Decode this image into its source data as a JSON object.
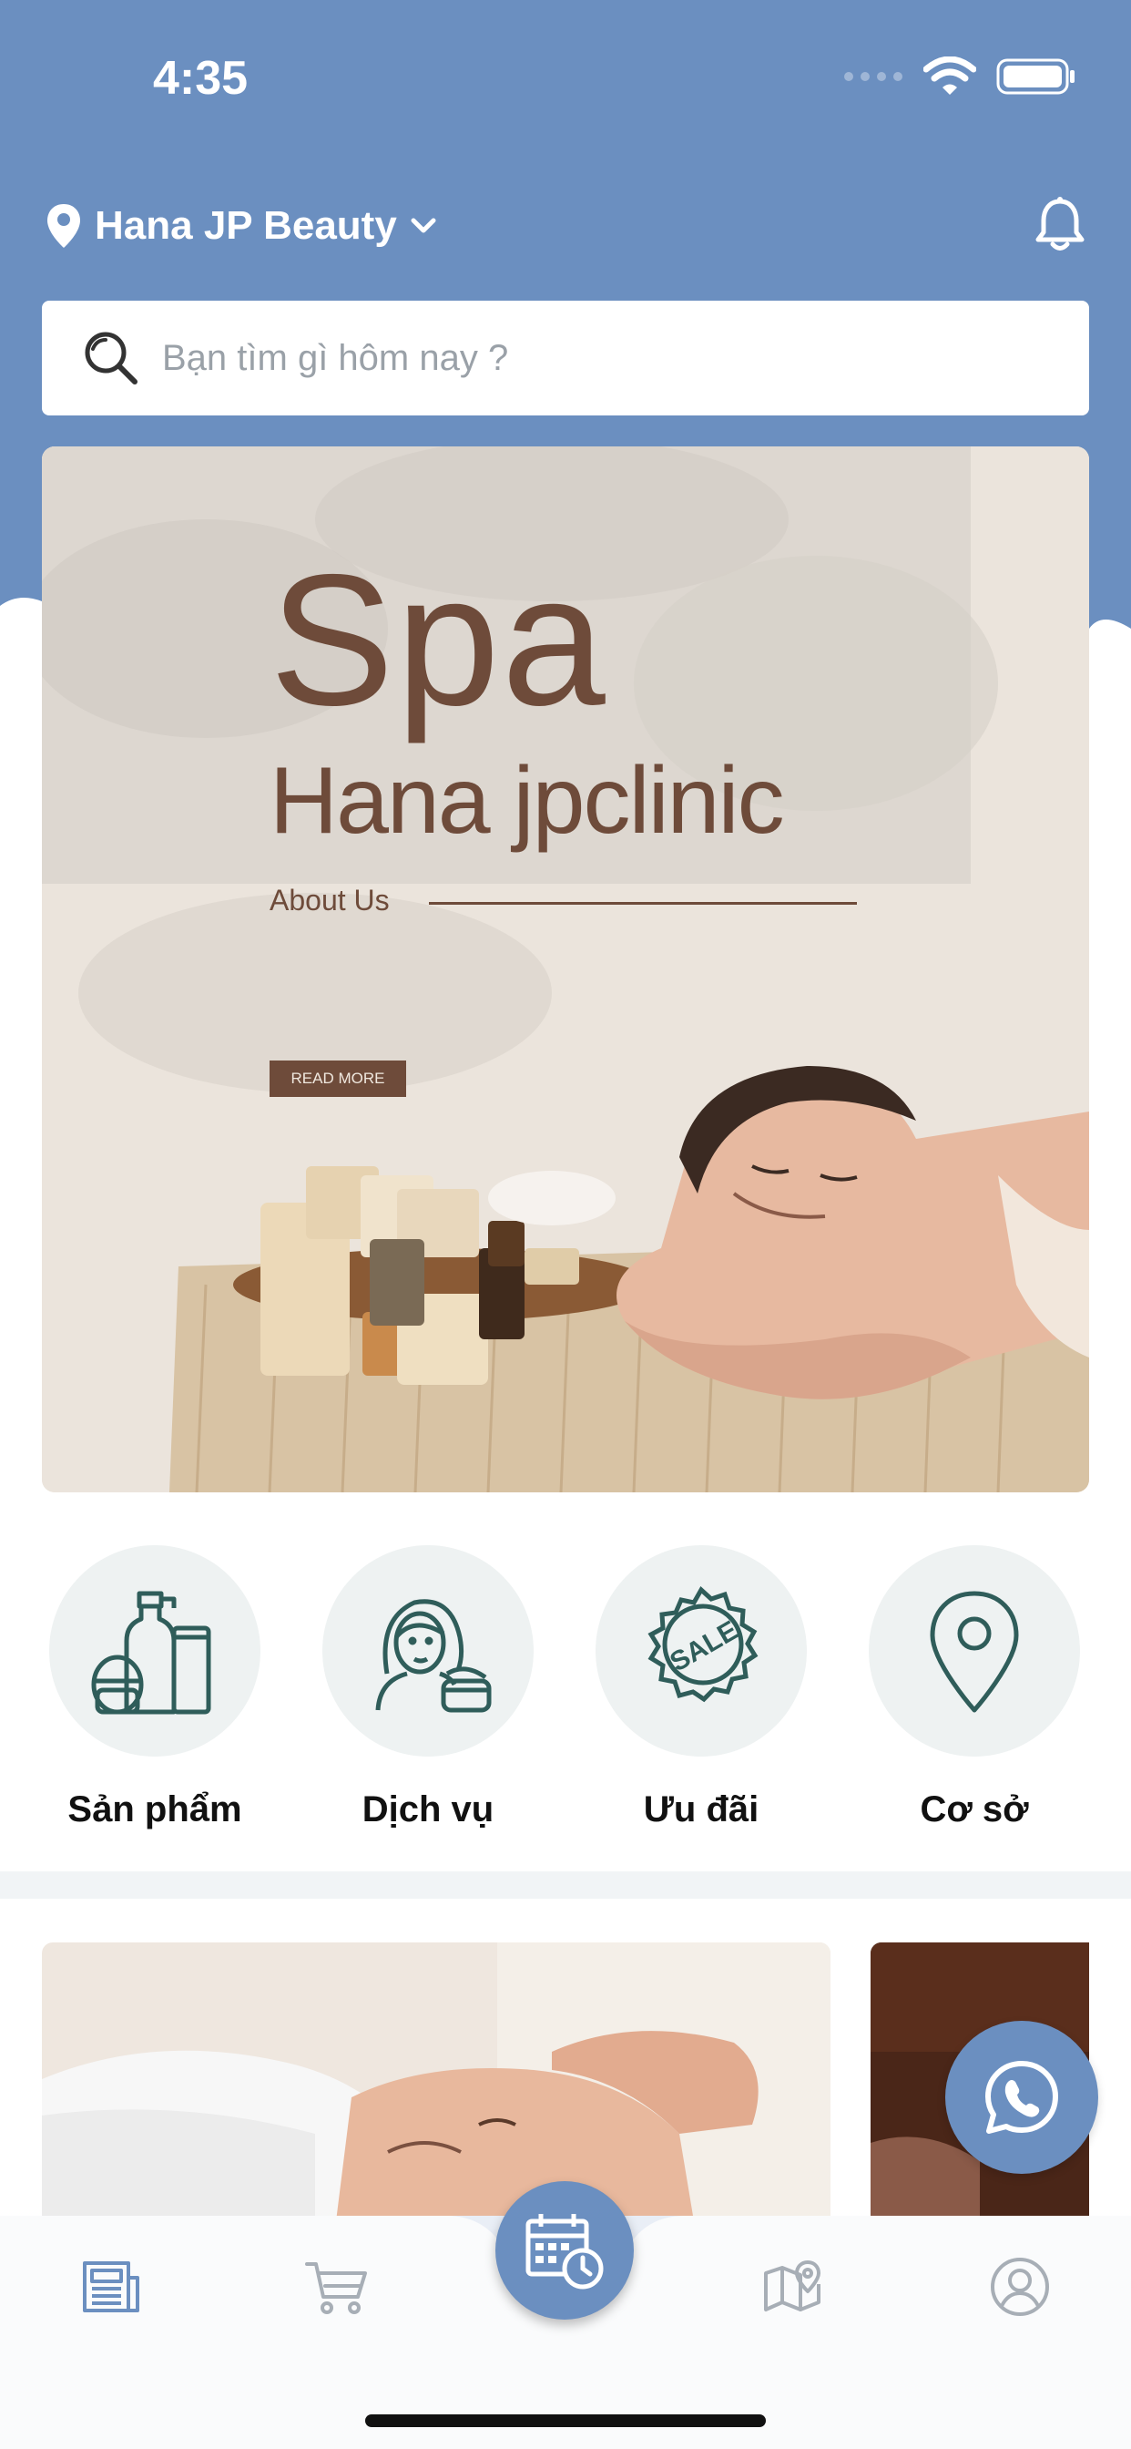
{
  "status": {
    "time": "4:35"
  },
  "header": {
    "location": "Hana JP Beauty"
  },
  "search": {
    "placeholder": "Bạn tìm gì hôm nay ?"
  },
  "banner": {
    "title": "Spa",
    "subtitle": "Hana jpclinic",
    "about": "About Us",
    "button": "READ MORE"
  },
  "categories": [
    {
      "label": "Sản phẩm",
      "icon": "cosmetics-icon"
    },
    {
      "label": "Dịch vụ",
      "icon": "service-woman-icon"
    },
    {
      "label": "Ưu đãi",
      "icon": "sale-badge-icon"
    },
    {
      "label": "Cơ sở",
      "icon": "map-pin-icon"
    }
  ],
  "tabs": [
    {
      "icon": "news-icon",
      "active": true
    },
    {
      "icon": "cart-icon",
      "active": false
    },
    {
      "icon": "calendar-clock-icon",
      "active": false
    },
    {
      "icon": "map-icon",
      "active": false
    },
    {
      "icon": "profile-icon",
      "active": false
    }
  ],
  "colors": {
    "primary": "#6b8fc0",
    "brown": "#6e4b3a",
    "icon_dark": "#2f5d5a"
  }
}
